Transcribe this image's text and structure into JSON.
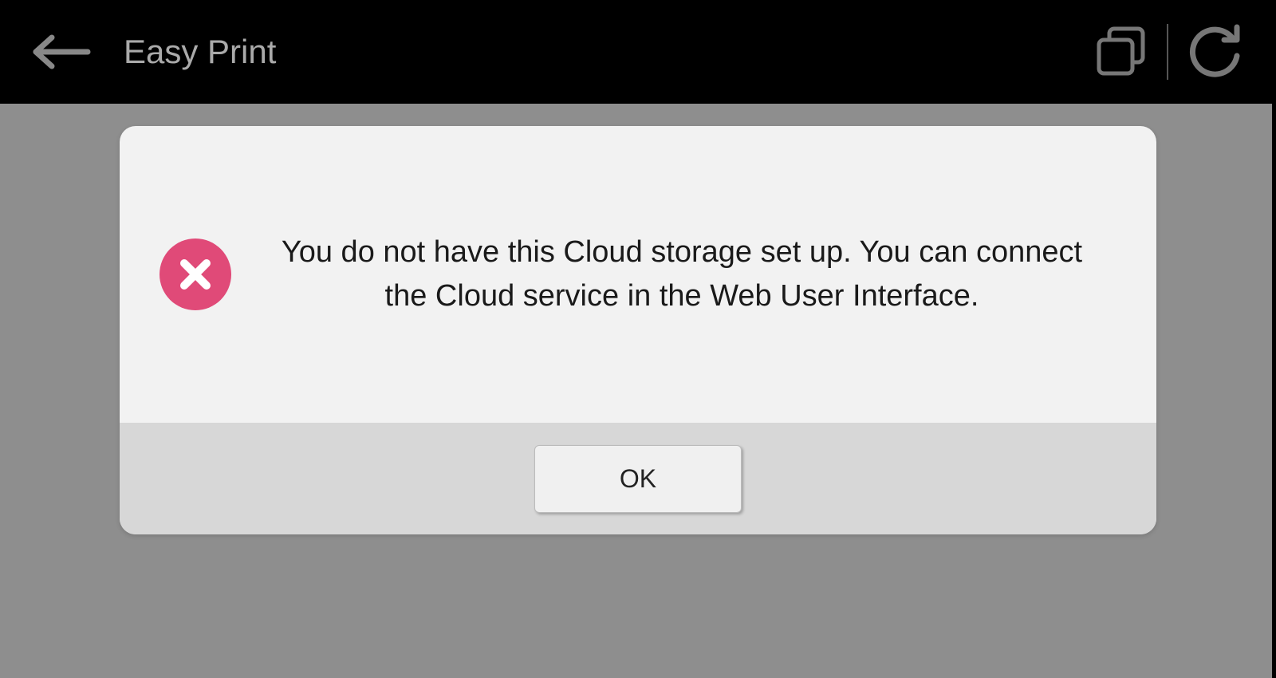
{
  "header": {
    "title": "Easy Print"
  },
  "dialog": {
    "message": "You do not have this Cloud storage set up. You can connect the Cloud service in the Web User Interface.",
    "ok_label": "OK"
  }
}
